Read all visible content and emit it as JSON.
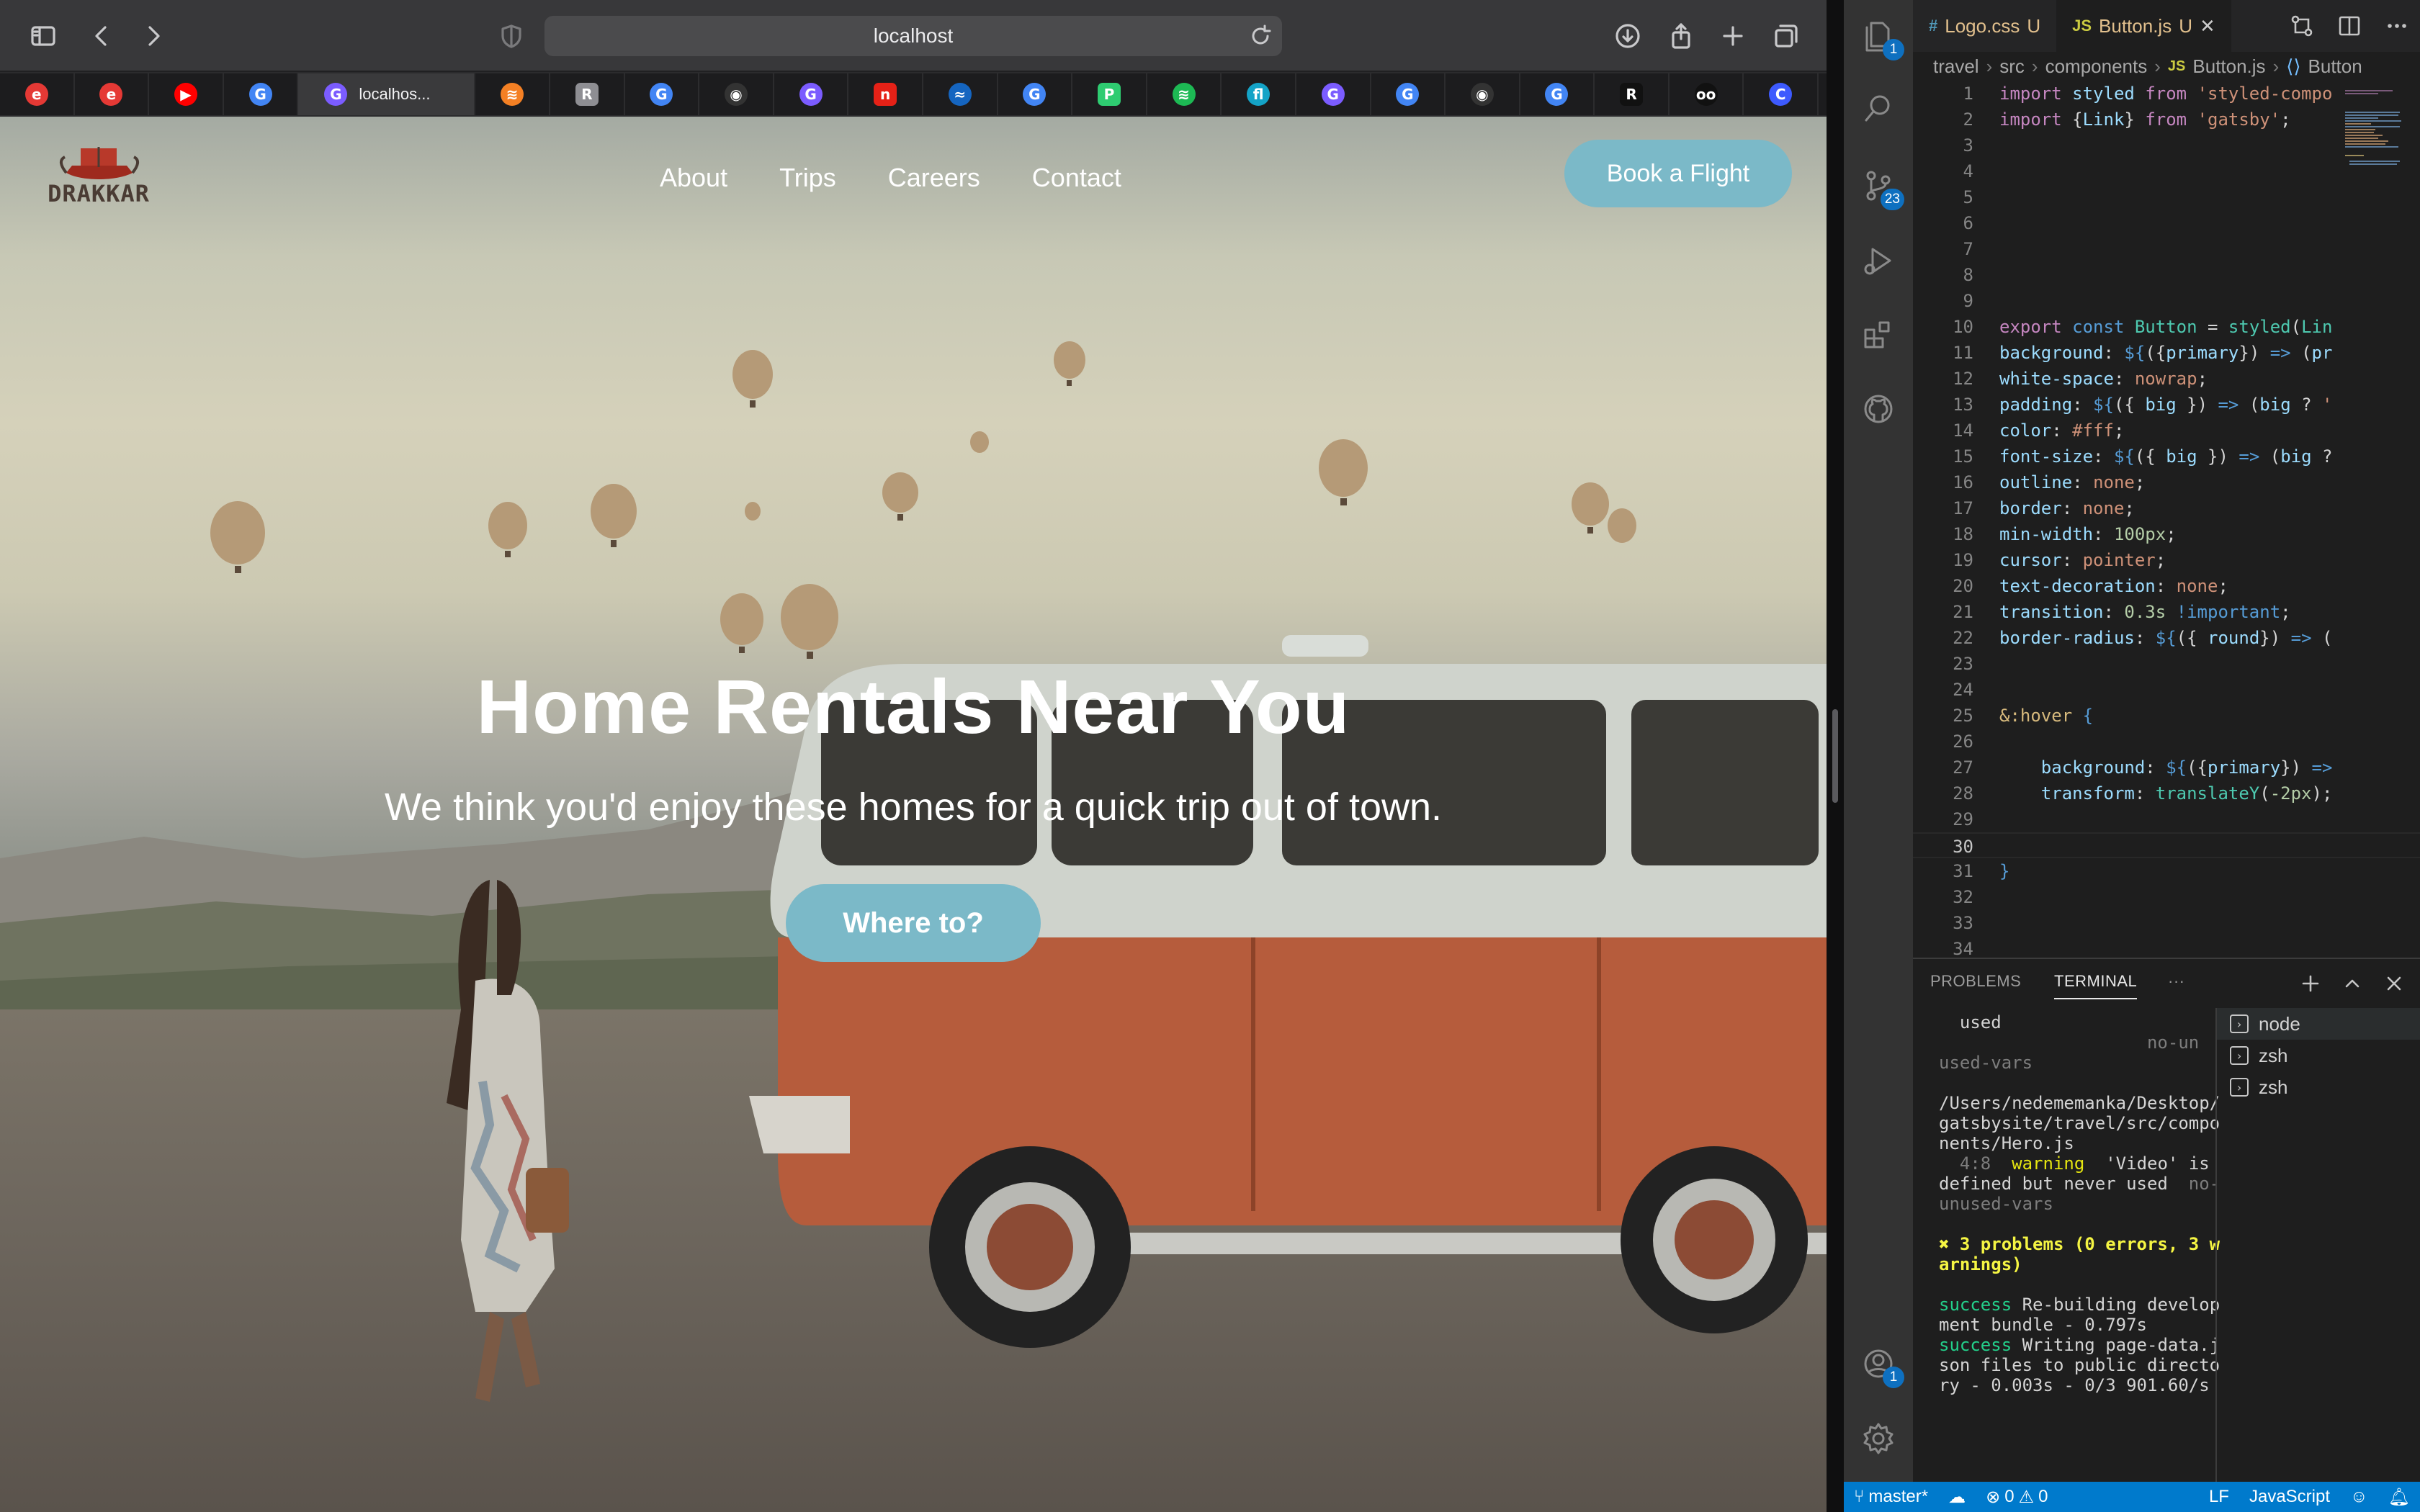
{
  "browser": {
    "url": "localhost",
    "tabs": [
      {
        "icon": "e",
        "color": "#e53935"
      },
      {
        "icon": "e",
        "color": "#e53935"
      },
      {
        "icon": "▶",
        "color": "#ff0000"
      },
      {
        "icon": "G",
        "color": "#4285f4"
      },
      {
        "icon": "G",
        "color": "#7b5cff",
        "label": "localhos...",
        "active": true
      },
      {
        "icon": "≋",
        "color": "#f48024"
      },
      {
        "icon": "R",
        "color": "#8e8e93"
      },
      {
        "icon": "G",
        "color": "#4285f4"
      },
      {
        "icon": "◉",
        "color": "#333333"
      },
      {
        "icon": "G",
        "color": "#7b5cff"
      },
      {
        "icon": "n",
        "color": "#e62117"
      },
      {
        "icon": "≈",
        "color": "#1565c0"
      },
      {
        "icon": "G",
        "color": "#4285f4"
      },
      {
        "icon": "P",
        "color": "#2ecc71"
      },
      {
        "icon": "≋",
        "color": "#1db954"
      },
      {
        "icon": "fl",
        "color": "#14a3c7"
      },
      {
        "icon": "G",
        "color": "#7b5cff"
      },
      {
        "icon": "G",
        "color": "#4285f4"
      },
      {
        "icon": "◉",
        "color": "#333333"
      },
      {
        "icon": "G",
        "color": "#4285f4"
      },
      {
        "icon": "R",
        "color": "#111111"
      },
      {
        "icon": "oo",
        "color": "#111111"
      },
      {
        "icon": "C",
        "color": "#3d5afe"
      }
    ]
  },
  "site": {
    "logo_text": "DRAKKAR",
    "nav": [
      "About",
      "Trips",
      "Careers",
      "Contact"
    ],
    "cta": "Book a Flight",
    "hero": {
      "title": "Home Rentals Near You",
      "subtitle": "We think you'd enjoy these homes for a quick trip out of town.",
      "button": "Where to?"
    },
    "accent_color": "#7bb9c8"
  },
  "vscode": {
    "activity_badges": {
      "explorer": "1",
      "source_control": "23",
      "accounts": "1"
    },
    "tabs": [
      {
        "icon": "#",
        "name": "Logo.css",
        "status": "U",
        "active": false
      },
      {
        "icon": "JS",
        "name": "Button.js",
        "status": "U",
        "active": true
      }
    ],
    "breadcrumbs": [
      "travel",
      "src",
      "components",
      "Button.js",
      "Button"
    ],
    "current_line": 30,
    "code_lines": [
      {
        "n": 1,
        "html": "<span class='kw'>import</span> <span class='pl'>styled</span> <span class='kw'>from</span> <span class='str'>'styled-compo</span>"
      },
      {
        "n": 2,
        "html": "<span class='kw'>import</span> {<span class='pl'>Link</span>} <span class='kw'>from</span> <span class='str'>'gatsby'</span>;"
      },
      {
        "n": 3,
        "html": ""
      },
      {
        "n": 4,
        "html": ""
      },
      {
        "n": 5,
        "html": ""
      },
      {
        "n": 6,
        "html": ""
      },
      {
        "n": 7,
        "html": ""
      },
      {
        "n": 8,
        "html": ""
      },
      {
        "n": 9,
        "html": ""
      },
      {
        "n": 10,
        "html": "<span class='kw'>export</span> <span class='kw2'>const</span> <span class='fn'>Button</span> = <span class='fn'>styled</span>(<span class='fn'>Lin</span>"
      },
      {
        "n": 11,
        "html": "<span class='pl'>background</span>: <span class='kw2'>${</span>({<span class='pl'>primary</span>}) <span class='kw2'>=&gt;</span> (<span class='pl'>pr</span>"
      },
      {
        "n": 12,
        "html": "<span class='pl'>white-space</span>: <span class='vl'>nowrap</span>;"
      },
      {
        "n": 13,
        "html": "<span class='pl'>padding</span>: <span class='kw2'>${</span>({ <span class='pl'>big</span> }) <span class='kw2'>=&gt;</span> (<span class='pl'>big</span> ? <span class='str'>'</span>"
      },
      {
        "n": 14,
        "html": "<span class='pl'>color</span>: <span class='vl'>#fff</span>;"
      },
      {
        "n": 15,
        "html": "<span class='pl'>font-size</span>: <span class='kw2'>${</span>({ <span class='pl'>big</span> }) <span class='kw2'>=&gt;</span> (<span class='pl'>big</span> ?"
      },
      {
        "n": 16,
        "html": "<span class='pl'>outline</span>: <span class='vl'>none</span>;"
      },
      {
        "n": 17,
        "html": "<span class='pl'>border</span>: <span class='vl'>none</span>;"
      },
      {
        "n": 18,
        "html": "<span class='pl'>min-width</span>: <span class='num'>100px</span>;"
      },
      {
        "n": 19,
        "html": "<span class='pl'>cursor</span>: <span class='vl'>pointer</span>;"
      },
      {
        "n": 20,
        "html": "<span class='pl'>text-decoration</span>: <span class='vl'>none</span>;"
      },
      {
        "n": 21,
        "html": "<span class='pl'>transition</span>: <span class='num'>0.3s</span> <span class='kw2'>!important</span>;"
      },
      {
        "n": 22,
        "html": "<span class='pl'>border-radius</span>: <span class='kw2'>${</span>({ <span class='pl'>round</span>}) <span class='kw2'>=&gt;</span> ("
      },
      {
        "n": 23,
        "html": ""
      },
      {
        "n": 24,
        "html": ""
      },
      {
        "n": 25,
        "html": "<span class='sel'>&amp;:hover</span> <span class='kw2'>{</span>"
      },
      {
        "n": 26,
        "html": ""
      },
      {
        "n": 27,
        "html": "    <span class='pl'>background</span>: <span class='kw2'>${</span>({<span class='pl'>primary</span>}) <span class='kw2'>=&gt;</span>"
      },
      {
        "n": 28,
        "html": "    <span class='pl'>transform</span>: <span class='fn'>translateY</span>(<span class='num'>-2px</span>);"
      },
      {
        "n": 29,
        "html": ""
      },
      {
        "n": 30,
        "html": ""
      },
      {
        "n": 31,
        "html": "<span class='kw2'>}</span>"
      },
      {
        "n": 32,
        "html": ""
      },
      {
        "n": 33,
        "html": ""
      },
      {
        "n": 34,
        "html": ""
      }
    ],
    "panel": {
      "tabs": [
        "PROBLEMS",
        "TERMINAL"
      ],
      "active_tab": "TERMINAL",
      "terminals": [
        "node",
        "zsh",
        "zsh"
      ],
      "output": [
        {
          "cls": "",
          "text": "  used"
        },
        {
          "cls": "t-gray",
          "text": "                    no-un"
        },
        {
          "cls": "t-gray",
          "text": "used-vars"
        },
        {
          "cls": "",
          "text": " "
        },
        {
          "cls": "",
          "text": "/Users/nedememanka/Desktop/gatsbysite/travel/src/components/Hero.js"
        },
        {
          "cls": "",
          "html": "  <span class='t-gray'>4:8</span>  <span class='t-yellow'>warning</span>  'Video' is defined but never used  <span class='t-gray'>no-unused-vars</span>"
        },
        {
          "cls": "",
          "text": " "
        },
        {
          "cls": "t-bold-yellow",
          "text": "✖ 3 problems (0 errors, 3 warnings)"
        },
        {
          "cls": "",
          "text": " "
        },
        {
          "cls": "",
          "html": "<span class='t-green'>success</span> Re-building development bundle - 0.797s"
        },
        {
          "cls": "",
          "html": "<span class='t-green'>success</span> Writing page-data.json files to public directory - 0.003s - 0/3 901.60/s"
        }
      ]
    },
    "status": {
      "branch": "master*",
      "errors": "0",
      "warnings": "0",
      "eol": "LF",
      "language": "JavaScript"
    }
  }
}
